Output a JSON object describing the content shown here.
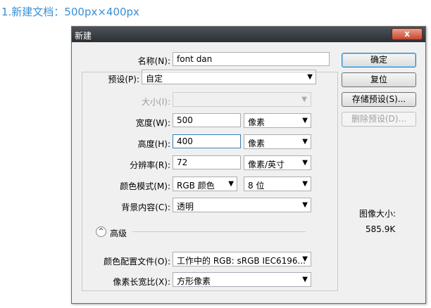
{
  "caption": "1.新建文档：500px×400px",
  "window": {
    "title": "新建",
    "close_glyph": "x"
  },
  "fields": {
    "name_label": "名称(N):",
    "name_value": "font dan",
    "preset_label": "预设(P):",
    "preset_value": "自定",
    "size_label": "大小(I):",
    "width_label": "宽度(W):",
    "width_value": "500",
    "width_unit": "像素",
    "height_label": "高度(H):",
    "height_value": "400",
    "height_unit": "像素",
    "resolution_label": "分辨率(R):",
    "resolution_value": "72",
    "resolution_unit": "像素/英寸",
    "color_mode_label": "颜色模式(M):",
    "color_mode_value": "RGB 颜色",
    "bit_depth_value": "8 位",
    "background_label": "背景内容(C):",
    "background_value": "透明",
    "advanced_label": "高级",
    "color_profile_label": "颜色配置文件(O):",
    "color_profile_value": "工作中的 RGB: sRGB IEC6196...",
    "pixel_aspect_label": "像素长宽比(X):",
    "pixel_aspect_value": "方形像素"
  },
  "buttons": {
    "ok": "确定",
    "reset": "复位",
    "save_preset": "存储预设(S)...",
    "delete_preset": "删除预设(D)..."
  },
  "info": {
    "image_size_label": "图像大小:",
    "image_size_value": "585.9K"
  },
  "icons": {
    "dropdown": "▼",
    "collapse": "^"
  },
  "colors": {
    "caption": "#3a8fd3",
    "close_button": "#c8462c",
    "default_button_border": "#3c7fb1"
  }
}
